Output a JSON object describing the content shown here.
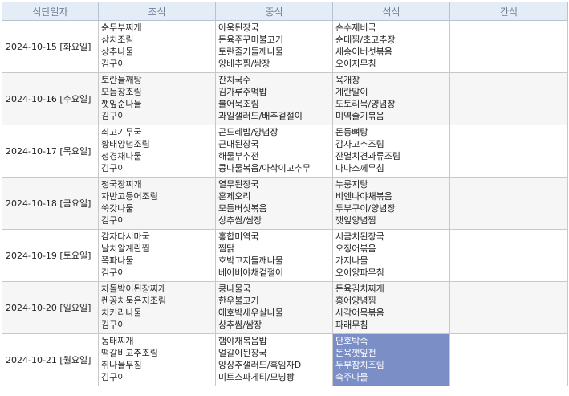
{
  "headers": [
    "식단일자",
    "조식",
    "중식",
    "석식",
    "간식"
  ],
  "rows": [
    {
      "date": "2024-10-15 [화요일]",
      "breakfast": [
        "순두부찌개",
        "삼치조림",
        "상추나물",
        "김구이"
      ],
      "lunch": [
        "아욱된장국",
        "돈육주꾸미불고기",
        "토란줄기들깨나물",
        "양배추찜/쌈장"
      ],
      "dinner": [
        "손수제비국",
        "순대찜/초고추장",
        "새송이버섯볶음",
        "오이지무침"
      ],
      "snack": []
    },
    {
      "date": "2024-10-16 [수요일]",
      "breakfast": [
        "토란들깨탕",
        "모듬장조림",
        "깻잎순나물",
        "김구이"
      ],
      "lunch": [
        "잔치국수",
        "김가루주먹밥",
        "불어묵조림",
        "과일샐러드/배추겉절이"
      ],
      "dinner": [
        "육개장",
        "계란말이",
        "도토리묵/양념장",
        "미역줄기볶음"
      ],
      "snack": []
    },
    {
      "date": "2024-10-17 [목요일]",
      "breakfast": [
        "쇠고기무국",
        "황태양념조림",
        "청경채나물",
        "김구이"
      ],
      "lunch": [
        "곤드레밥/양념장",
        "근대된장국",
        "해물부추전",
        "콩나물볶음/아삭이고추무"
      ],
      "dinner": [
        "돈등뼈탕",
        "감자고추조림",
        "잔멸치견과류조림",
        "나나스께무침"
      ],
      "snack": []
    },
    {
      "date": "2024-10-18 [금요일]",
      "breakfast": [
        "청국장찌개",
        "자반고등어조림",
        "쑥갓나물",
        "김구이"
      ],
      "lunch": [
        "열무된장국",
        "훈제오리",
        "모듬버섯볶음",
        "상추쌈/쌈장"
      ],
      "dinner": [
        "누룽지탕",
        "비엔나야채볶음",
        "두부구이/양념장",
        "깻잎양념찜"
      ],
      "snack": []
    },
    {
      "date": "2024-10-19 [토요일]",
      "breakfast": [
        "감자다시마국",
        "날치알계란찜",
        "쪽파나물",
        "김구이"
      ],
      "lunch": [
        "홍합미역국",
        "찜닭",
        "호박고지들깨나물",
        "베이비야채겉절이"
      ],
      "dinner": [
        "시금치된장국",
        "오징어볶음",
        "가지나물",
        "오이양파무침"
      ],
      "snack": []
    },
    {
      "date": "2024-10-20 [일요일]",
      "breakfast": [
        "차돌박이된장찌개",
        "켄꽁치묵은지조림",
        "치커리나물",
        "김구이"
      ],
      "lunch": [
        "콩나물국",
        "한우불고기",
        "애호박새우살나물",
        "상추쌈/쌈장"
      ],
      "dinner": [
        "돈육김치찌개",
        "홍어양념찜",
        "사각어묵볶음",
        "파래무침"
      ],
      "snack": []
    },
    {
      "date": "2024-10-21 [월요일]",
      "breakfast": [
        "동태찌개",
        "떡갈비고추조림",
        "취나물무침",
        "김구이"
      ],
      "lunch": [
        "햄야채볶음밥",
        "얼갈이된장국",
        "양상추샐러드/흑임자D",
        "미트스파게티/모닝빵"
      ],
      "dinner": [
        "단호박죽",
        "돈육깻잎전",
        "두부참치조림",
        "숙주나물"
      ],
      "snack": []
    }
  ],
  "highlight": {
    "row": 6,
    "column": "dinner",
    "color": "#7b8ec6"
  }
}
